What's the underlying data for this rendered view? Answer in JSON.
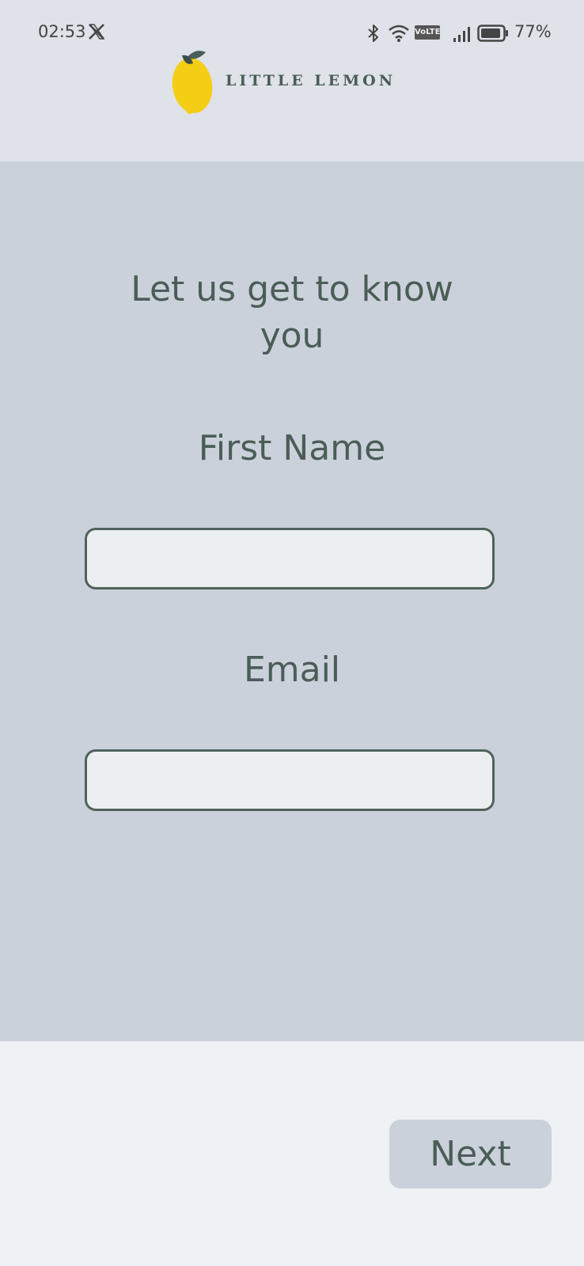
{
  "status_bar": {
    "time": "02:53",
    "volte": "VoLTE",
    "battery": "77%",
    "icons": [
      "x-icon",
      "bluetooth-icon",
      "wifi-icon",
      "volte-icon",
      "signal-icon",
      "battery-icon"
    ]
  },
  "header": {
    "logo_text": "LITTLE LEMON"
  },
  "form": {
    "title": "Let us get to know you",
    "first_name_label": "First Name",
    "first_name_value": "",
    "email_label": "Email",
    "email_value": ""
  },
  "footer": {
    "next_label": "Next"
  },
  "colors": {
    "primary": "#495E57",
    "lemon": "#F4CE14",
    "panel": "#CBD1DA",
    "header": "#DFE2E8",
    "footer": "#EEF2F5"
  }
}
